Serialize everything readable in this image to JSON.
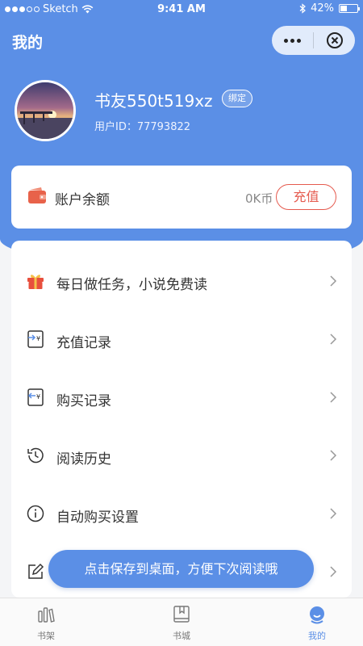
{
  "status_bar": {
    "carrier": "Sketch",
    "time": "9:41 AM",
    "battery": "42%",
    "battery_level": 0.42
  },
  "header": {
    "title": "我的"
  },
  "profile": {
    "username": "书友550t519xz",
    "bind_label": "绑定",
    "user_id": "用户ID：77793822"
  },
  "balance": {
    "label": "账户余额",
    "value": "0K币",
    "recharge_label": "充值"
  },
  "menu": {
    "items": [
      {
        "label": "每日做任务，小说免费读",
        "icon": "gift-icon"
      },
      {
        "label": "充值记录",
        "icon": "recharge-record-icon"
      },
      {
        "label": "购买记录",
        "icon": "purchase-record-icon"
      },
      {
        "label": "阅读历史",
        "icon": "history-clock-icon"
      },
      {
        "label": "自动购买设置",
        "icon": "info-icon"
      },
      {
        "label": "",
        "icon": "edit-icon"
      }
    ]
  },
  "toast": {
    "text": "点击保存到桌面，方便下次阅读哦"
  },
  "tabbar": {
    "tabs": [
      {
        "label": "书架",
        "icon": "bookshelf-icon"
      },
      {
        "label": "书城",
        "icon": "bookstore-icon"
      },
      {
        "label": "我的",
        "icon": "profile-icon"
      }
    ],
    "active": "我的"
  },
  "colors": {
    "accent": "#5b8fe6",
    "recharge": "#e55a4e",
    "gift": "#e84f3d",
    "wallet": "#e8624a"
  }
}
